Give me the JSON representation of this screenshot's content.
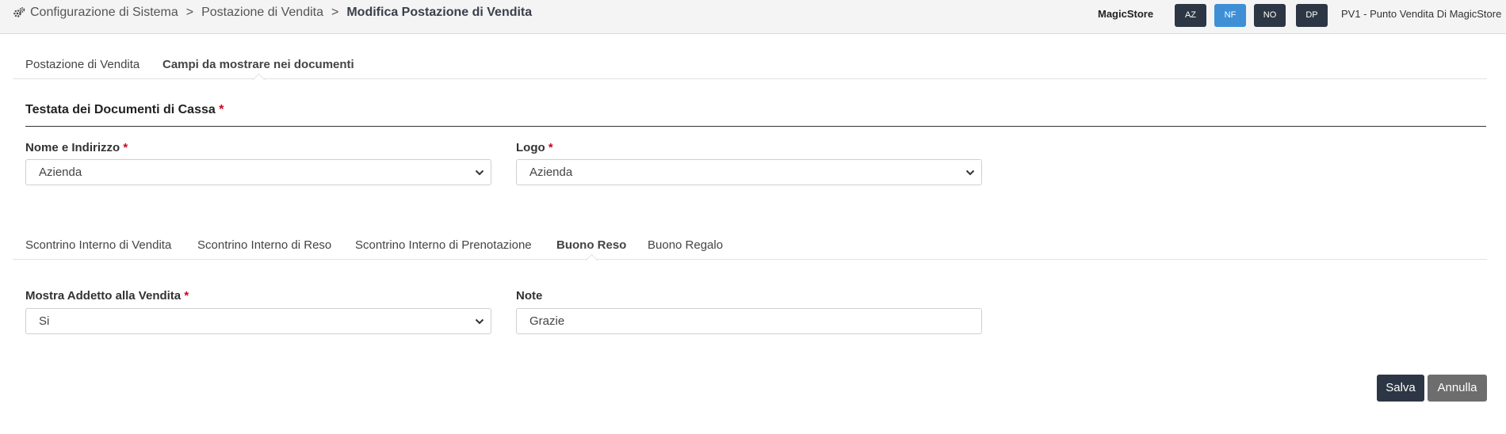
{
  "header": {
    "breadcrumb": [
      "Configurazione di Sistema",
      "Postazione di Vendita"
    ],
    "breadcrumb_separator": ">",
    "breadcrumb_current": "Modifica Postazione di Vendita",
    "store_name": "MagicStore",
    "codes": [
      {
        "label": "AZ",
        "active": false
      },
      {
        "label": "NF",
        "active": true
      },
      {
        "label": "NO",
        "active": false
      },
      {
        "label": "DP",
        "active": false
      }
    ],
    "pv_label": "PV1 - Punto Vendita Di MagicStore"
  },
  "main_tabs": [
    {
      "label": "Postazione di Vendita",
      "active": false
    },
    {
      "label": "Campi da mostrare nei documenti",
      "active": true
    }
  ],
  "section": {
    "title": "Testata dei Documenti di Cassa",
    "required_mark": "*"
  },
  "header_fields": {
    "nome_label": "Nome e Indirizzo",
    "nome_value": "Azienda",
    "logo_label": "Logo",
    "logo_value": "Azienda",
    "required_mark": "*"
  },
  "doc_tabs": [
    {
      "label": "Scontrino Interno di Vendita",
      "active": false
    },
    {
      "label": "Scontrino Interno di Reso",
      "active": false
    },
    {
      "label": "Scontrino Interno di Prenotazione",
      "active": false
    },
    {
      "label": "Buono Reso",
      "active": true
    },
    {
      "label": "Buono Regalo",
      "active": false
    }
  ],
  "doc_fields": {
    "addetto_label": "Mostra Addetto alla Vendita",
    "addetto_value": "Si",
    "note_label": "Note",
    "note_value": "Grazie",
    "required_mark": "*"
  },
  "actions": {
    "save": "Salva",
    "cancel": "Annulla"
  },
  "colors": {
    "primary_dark": "#2d3644",
    "accent_blue": "#3e8fd6",
    "cancel_gray": "#6d6d6d",
    "required_red": "#d0021b"
  },
  "icons": {
    "breadcrumb": "gears-icon",
    "select": "chevron-down-icon"
  }
}
